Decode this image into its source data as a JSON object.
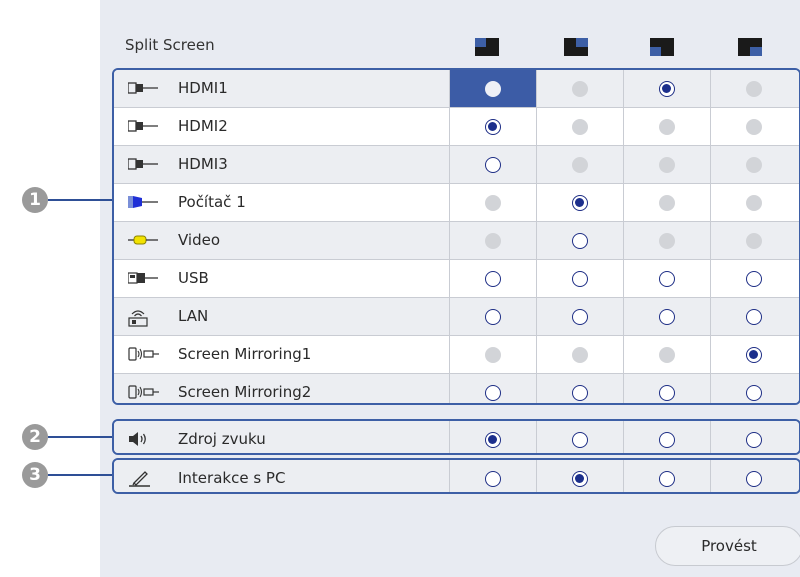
{
  "title": "Split Screen",
  "layout_icons": [
    "layout-left-top-icon",
    "layout-right-top-icon",
    "layout-left-bottom-icon",
    "layout-right-bottom-icon"
  ],
  "sources": [
    {
      "label": "HDMI1",
      "icon": "hdmi-icon",
      "cells": [
        "selected",
        "disabled",
        "checked",
        "disabled"
      ]
    },
    {
      "label": "HDMI2",
      "icon": "hdmi-icon",
      "cells": [
        "checked",
        "disabled",
        "disabled",
        "disabled"
      ]
    },
    {
      "label": "HDMI3",
      "icon": "hdmi-icon",
      "cells": [
        "empty",
        "disabled",
        "disabled",
        "disabled"
      ]
    },
    {
      "label": "Počítač 1",
      "icon": "computer-vga-icon",
      "cells": [
        "disabled",
        "checked",
        "disabled",
        "disabled"
      ]
    },
    {
      "label": "Video",
      "icon": "video-rca-icon",
      "cells": [
        "disabled",
        "empty",
        "disabled",
        "disabled"
      ]
    },
    {
      "label": "USB",
      "icon": "usb-icon",
      "cells": [
        "empty",
        "empty",
        "empty",
        "empty"
      ]
    },
    {
      "label": "LAN",
      "icon": "lan-icon",
      "cells": [
        "empty",
        "empty",
        "empty",
        "empty"
      ]
    },
    {
      "label": "Screen Mirroring1",
      "icon": "screen-mirroring-icon",
      "cells": [
        "disabled",
        "disabled",
        "disabled",
        "checked"
      ]
    },
    {
      "label": "Screen Mirroring2",
      "icon": "screen-mirroring-icon",
      "cells": [
        "empty",
        "empty",
        "empty",
        "empty"
      ]
    }
  ],
  "audio": {
    "label": "Zdroj zvuku",
    "icon": "speaker-icon",
    "cells": [
      "checked",
      "empty",
      "empty",
      "empty"
    ]
  },
  "pc_interaction": {
    "label": "Interakce s PC",
    "icon": "pen-icon",
    "cells": [
      "empty",
      "checked",
      "empty",
      "empty"
    ]
  },
  "callouts": [
    "1",
    "2",
    "3"
  ],
  "execute_label": "Provést",
  "colors": {
    "accent": "#3c5ca6",
    "border": "#3d5fa6",
    "panel": "#e8ebf2",
    "radio": "#1c2f8c",
    "callout": "#9a9a9a"
  }
}
